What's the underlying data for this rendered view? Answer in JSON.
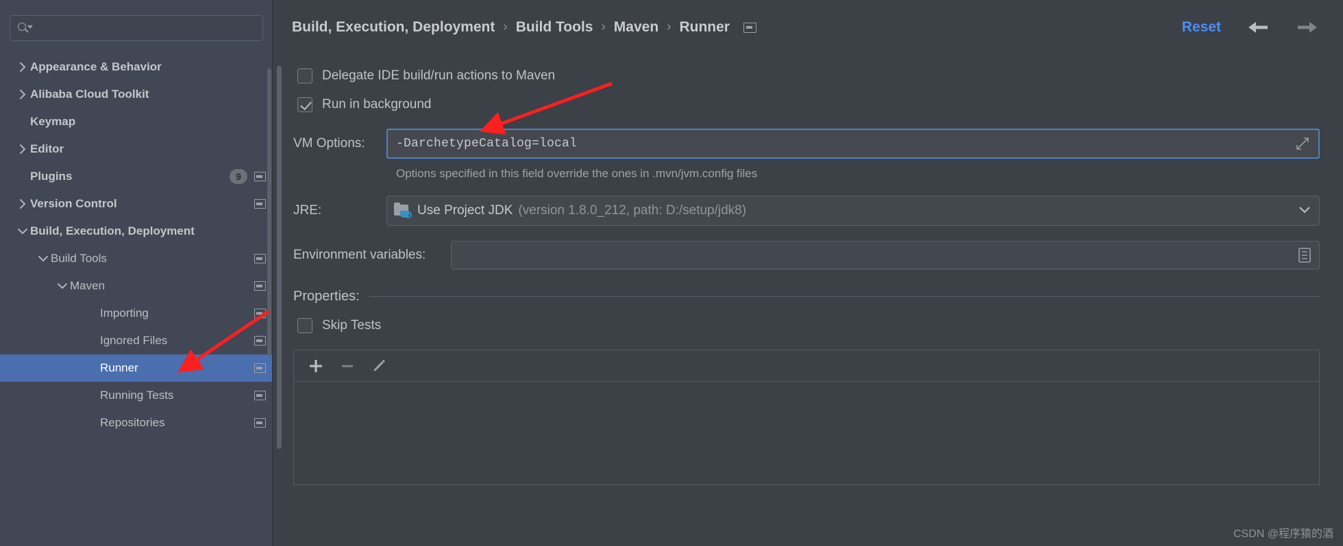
{
  "search": {
    "placeholder": "",
    "value": "",
    "icon": "search-icon"
  },
  "sidebar": {
    "items": [
      {
        "label": "Appearance & Behavior",
        "level": 0,
        "arrow": "chevron-right",
        "badge": null,
        "project_icon": false,
        "selected": false
      },
      {
        "label": "Alibaba Cloud Toolkit",
        "level": 0,
        "arrow": "chevron-right",
        "badge": null,
        "project_icon": false,
        "selected": false
      },
      {
        "label": "Keymap",
        "level": 0,
        "arrow": "none",
        "badge": null,
        "project_icon": false,
        "selected": false
      },
      {
        "label": "Editor",
        "level": 0,
        "arrow": "chevron-right",
        "badge": null,
        "project_icon": false,
        "selected": false
      },
      {
        "label": "Plugins",
        "level": 0,
        "arrow": "none",
        "badge": "9",
        "project_icon": true,
        "selected": false
      },
      {
        "label": "Version Control",
        "level": 0,
        "arrow": "chevron-right",
        "badge": null,
        "project_icon": true,
        "selected": false
      },
      {
        "label": "Build, Execution, Deployment",
        "level": 0,
        "arrow": "chevron-down",
        "badge": null,
        "project_icon": false,
        "selected": false
      },
      {
        "label": "Build Tools",
        "level": 1,
        "arrow": "chevron-down",
        "badge": null,
        "project_icon": true,
        "selected": false
      },
      {
        "label": "Maven",
        "level": 2,
        "arrow": "chevron-down",
        "badge": null,
        "project_icon": true,
        "selected": false
      },
      {
        "label": "Importing",
        "level": 3,
        "arrow": "none",
        "badge": null,
        "project_icon": true,
        "selected": false
      },
      {
        "label": "Ignored Files",
        "level": 3,
        "arrow": "none",
        "badge": null,
        "project_icon": true,
        "selected": false
      },
      {
        "label": "Runner",
        "level": 3,
        "arrow": "none",
        "badge": null,
        "project_icon": true,
        "selected": true
      },
      {
        "label": "Running Tests",
        "level": 3,
        "arrow": "none",
        "badge": null,
        "project_icon": true,
        "selected": false
      },
      {
        "label": "Repositories",
        "level": 3,
        "arrow": "none",
        "badge": null,
        "project_icon": true,
        "selected": false
      }
    ]
  },
  "header": {
    "breadcrumb": [
      "Build, Execution, Deployment",
      "Build Tools",
      "Maven",
      "Runner"
    ],
    "separator": "›",
    "project_icon": "project-scope-icon",
    "reset_label": "Reset",
    "back_icon": "arrow-left-icon",
    "forward_icon": "arrow-right-icon"
  },
  "main": {
    "delegate_checkbox": {
      "label": "Delegate IDE build/run actions to Maven",
      "checked": false
    },
    "run_background_checkbox": {
      "label": "Run in background",
      "checked": true
    },
    "vm_options": {
      "label": "VM Options:",
      "value": "-DarchetypeCatalog=local",
      "expand_icon": "expand-icon",
      "hint": "Options specified in this field override the ones in .mvn/jvm.config files"
    },
    "jre": {
      "label": "JRE:",
      "value": "Use Project JDK",
      "detail": "(version 1.8.0_212, path: D:/setup/jdk8)",
      "icon": "jdk-folder-icon",
      "dropdown_icon": "chevron-down-icon"
    },
    "environment_variables": {
      "label": "Environment variables:",
      "value": "",
      "browse_icon": "browse-list-icon"
    },
    "properties": {
      "title": "Properties:",
      "skip_tests": {
        "label": "Skip Tests",
        "checked": false
      },
      "toolbar": [
        {
          "name": "add-property-button",
          "glyph": "+"
        },
        {
          "name": "remove-property-button",
          "glyph": "−"
        },
        {
          "name": "edit-property-button",
          "glyph": "pencil"
        }
      ],
      "rows": []
    }
  },
  "watermark": {
    "text": "CSDN @程序猿的酒"
  },
  "colors": {
    "selection": "#4b6eaf",
    "accent_link": "#4b8ef7",
    "focus_border": "#4f82c2",
    "annotation_arrow": "#fa2020",
    "sidebar_bg": "#414754",
    "content_bg": "#3c4047"
  }
}
